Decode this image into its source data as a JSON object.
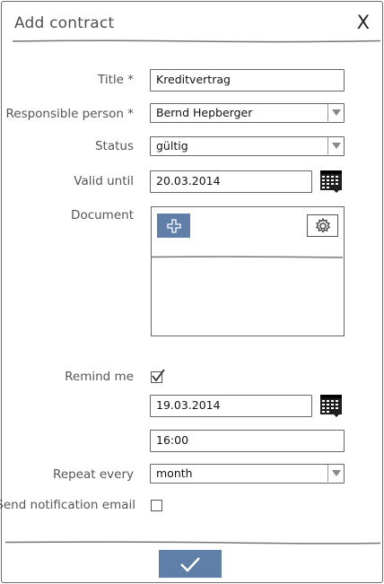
{
  "dialog": {
    "title": "Add contract",
    "close_label": "X"
  },
  "form": {
    "title": {
      "label": "Title *",
      "value": "Kreditvertrag"
    },
    "responsible": {
      "label": "Responsible person *",
      "value": "Bernd Hepberger"
    },
    "status": {
      "label": "Status",
      "value": "gültig"
    },
    "valid_until": {
      "label": "Valid until",
      "value": "20.03.2014"
    },
    "document": {
      "label": "Document"
    },
    "remind_me": {
      "label": "Remind me",
      "checked": true,
      "date": "19.03.2014",
      "time": "16:00"
    },
    "repeat_every": {
      "label": "Repeat every",
      "value": "month"
    },
    "send_email": {
      "label": "Send notification email",
      "checked": false
    }
  },
  "icons": {
    "calendar": "calendar-icon",
    "add": "plus-icon",
    "settings": "gear-icon",
    "submit": "checkmark-icon",
    "dropdown": "chevron-down-icon"
  },
  "colors": {
    "accent": "#5f7fa8",
    "border": "#666666",
    "text": "#555555"
  }
}
